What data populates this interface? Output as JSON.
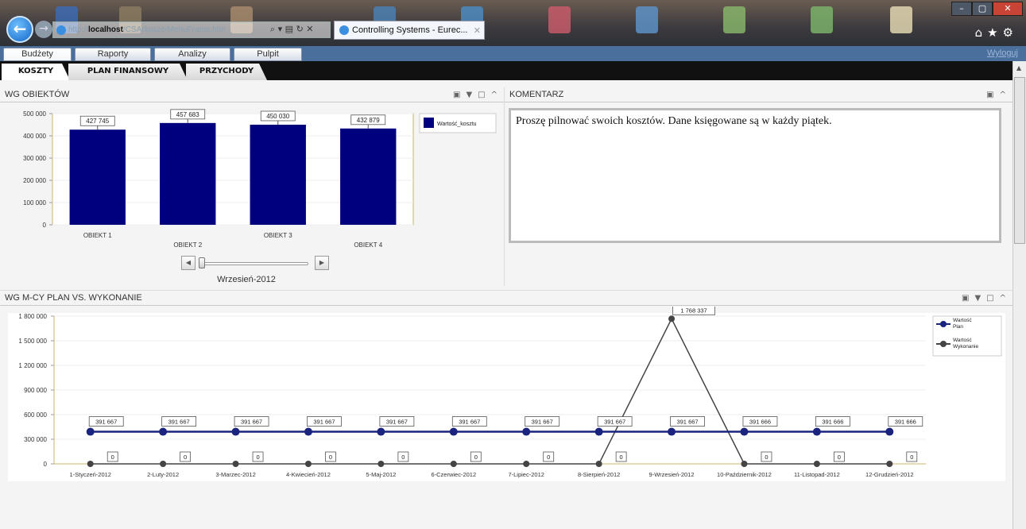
{
  "browser": {
    "address_prefix": "http://",
    "address_host": "localhost",
    "address_path": "/CSArkusze/MenuFrame.htm",
    "tab_title": "Controlling Systems - Eurec..."
  },
  "menu": {
    "tabs": [
      "Budżety",
      "Raporty",
      "Analizy",
      "Pulpit"
    ],
    "logout": "Wyloguj"
  },
  "subtabs": [
    "KOSZTY",
    "PLAN FINANSOWY",
    "PRZYCHODY"
  ],
  "panel_objects": {
    "title": "WG OBIEKTÓW",
    "slider_label": "Wrzesień-2012"
  },
  "panel_comment": {
    "title": "KOMENTARZ",
    "text": "Proszę pilnować swoich kosztów. Dane księgowane są w każdy piątek."
  },
  "panel_monthly": {
    "title": "WG M-CY PLAN VS. WYKONANIE"
  },
  "chart_data": [
    {
      "type": "bar",
      "categories": [
        "OBIEKT 1",
        "OBIEKT 2",
        "OBIEKT 3",
        "OBIEKT 4"
      ],
      "series": [
        {
          "name": "Wartość_kosztu",
          "values": [
            427745,
            457683,
            450030,
            432879
          ]
        }
      ],
      "data_labels": [
        "427 745",
        "457 683",
        "450 030",
        "432 879"
      ],
      "yticks": [
        "0",
        "100 000",
        "200 000",
        "300 000",
        "400 000",
        "500 000"
      ],
      "ylim": [
        0,
        500000
      ],
      "legend": "right",
      "color": "#00007f"
    },
    {
      "type": "line",
      "x": [
        "1-Styczeń-2012",
        "2-Luty-2012",
        "3-Marzec-2012",
        "4-Kwiecień-2012",
        "5-Maj-2012",
        "6-Czerwiec-2012",
        "7-Lipiec-2012",
        "8-Sierpień-2012",
        "9-Wrzesień-2012",
        "10-Październik-2012",
        "11-Listopad-2012",
        "12-Grudzień-2012"
      ],
      "series": [
        {
          "name": "Wartość Plan",
          "color": "#1a237e",
          "values": [
            391667,
            391667,
            391667,
            391667,
            391667,
            391667,
            391667,
            391667,
            391667,
            391666,
            391666,
            391666
          ],
          "labels": [
            "391 667",
            "391 667",
            "391 667",
            "391 667",
            "391 667",
            "391 667",
            "391 667",
            "391 667",
            "391 667",
            "391 666",
            "391 666",
            "391 666"
          ]
        },
        {
          "name": "Wartość Wykonanie",
          "color": "#444444",
          "values": [
            0,
            0,
            0,
            0,
            0,
            0,
            0,
            0,
            1768337,
            0,
            0,
            0
          ],
          "labels": [
            "0",
            "0",
            "0",
            "0",
            "0",
            "0",
            "0",
            "0",
            "1 768 337",
            "0",
            "0",
            "0"
          ]
        }
      ],
      "yticks": [
        "0",
        "300 000",
        "600 000",
        "900 000",
        "1 200 000",
        "1 500 000",
        "1 800 000"
      ],
      "ylim": [
        0,
        1800000
      ],
      "legend": "right"
    }
  ]
}
